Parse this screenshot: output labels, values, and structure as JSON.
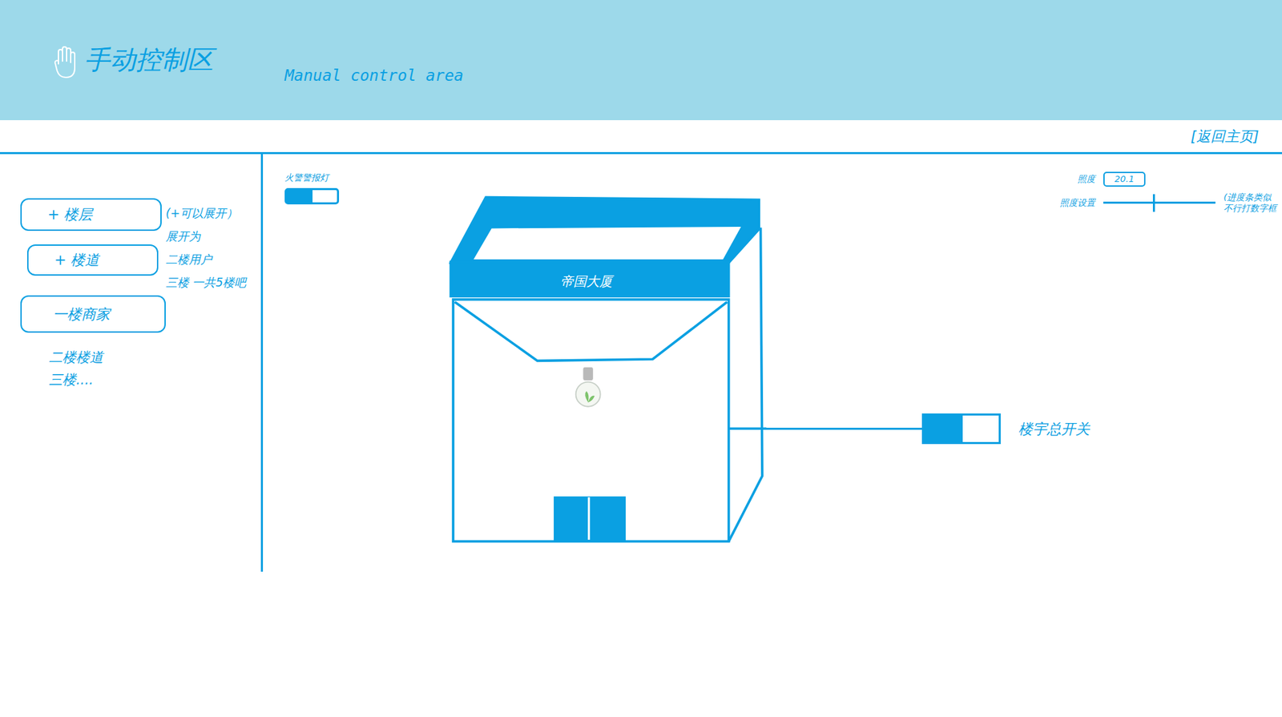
{
  "header": {
    "title": "手动控制区",
    "subtitle": "Manual control area"
  },
  "nav": {
    "back_link": "[返回主页]"
  },
  "sidebar": {
    "items": [
      {
        "label": "+ 楼层"
      },
      {
        "label": "+ 楼道"
      },
      {
        "label": "一楼商家"
      }
    ],
    "sub_items": [
      "二楼楼道",
      "三楼...."
    ],
    "notes": [
      "(+可以展开）",
      "展开为",
      "二楼用户",
      "三楼 一共5楼吧"
    ]
  },
  "fire_alarm": {
    "label": "火警警报灯",
    "on": true
  },
  "illuminance": {
    "label": "照度",
    "value": "20.1",
    "setting_label": "照度设置",
    "level": 0.44,
    "note": [
      "(进度条类似",
      "不行打数字框"
    ]
  },
  "building": {
    "name": "帝国大厦",
    "master_switch": {
      "label": "楼宇总开关",
      "on": true
    }
  }
}
